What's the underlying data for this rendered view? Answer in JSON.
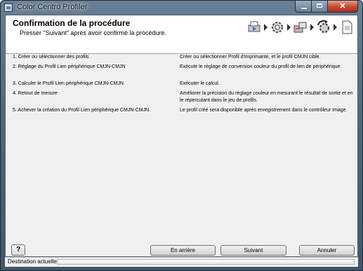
{
  "window": {
    "title": "Color Centro Profiler",
    "close_glyph": "✕"
  },
  "header": {
    "title": "Confirmation de la procédure",
    "subtitle": "Presser \"Suivant\" après avoir confirmé la procédure.",
    "step_icons": [
      "printer-icon",
      "gear-icon",
      "devices-icon",
      "refresh-gear-icon",
      "document-icon"
    ]
  },
  "steps": [
    {
      "action": "1. Créer ou sélectionner des profils",
      "description": "Créer ou sélectionner Profil d'imprimante, et le profil CMJN cible."
    },
    {
      "action": "2. Réglage du Profil Lien périphérique CMJN-CMJN",
      "description": "Exécute le réglage de conversion couleur du profil de lien de périphérique."
    },
    {
      "action": "3. Calculer le Profil Lien périphérique CMJN-CMJN",
      "description": "Exécuter le calcul."
    },
    {
      "action": "4. Retour de mesure",
      "description": "Améliorer la précision du réglage couleur en mesurant le résultat de sortie et en le répercutant dans le jeu de profils."
    },
    {
      "action": "5. Achever la création du Profil Lien périphérique CMJN-CMJN.",
      "description": "Le profil créé sera disponible après enregistrement dans le contrôleur Image."
    }
  ],
  "buttons": {
    "help": "?",
    "back": "En arrière",
    "next": "Suivant",
    "cancel": "Annuler"
  },
  "status": {
    "label": "Destination actuelle",
    "progress": 0.0
  },
  "colors": {
    "title_bar": "#51677d",
    "close_button": "#c24a30",
    "dialog_bg": "#f0f0f0",
    "header_bg": "#ffffff"
  }
}
